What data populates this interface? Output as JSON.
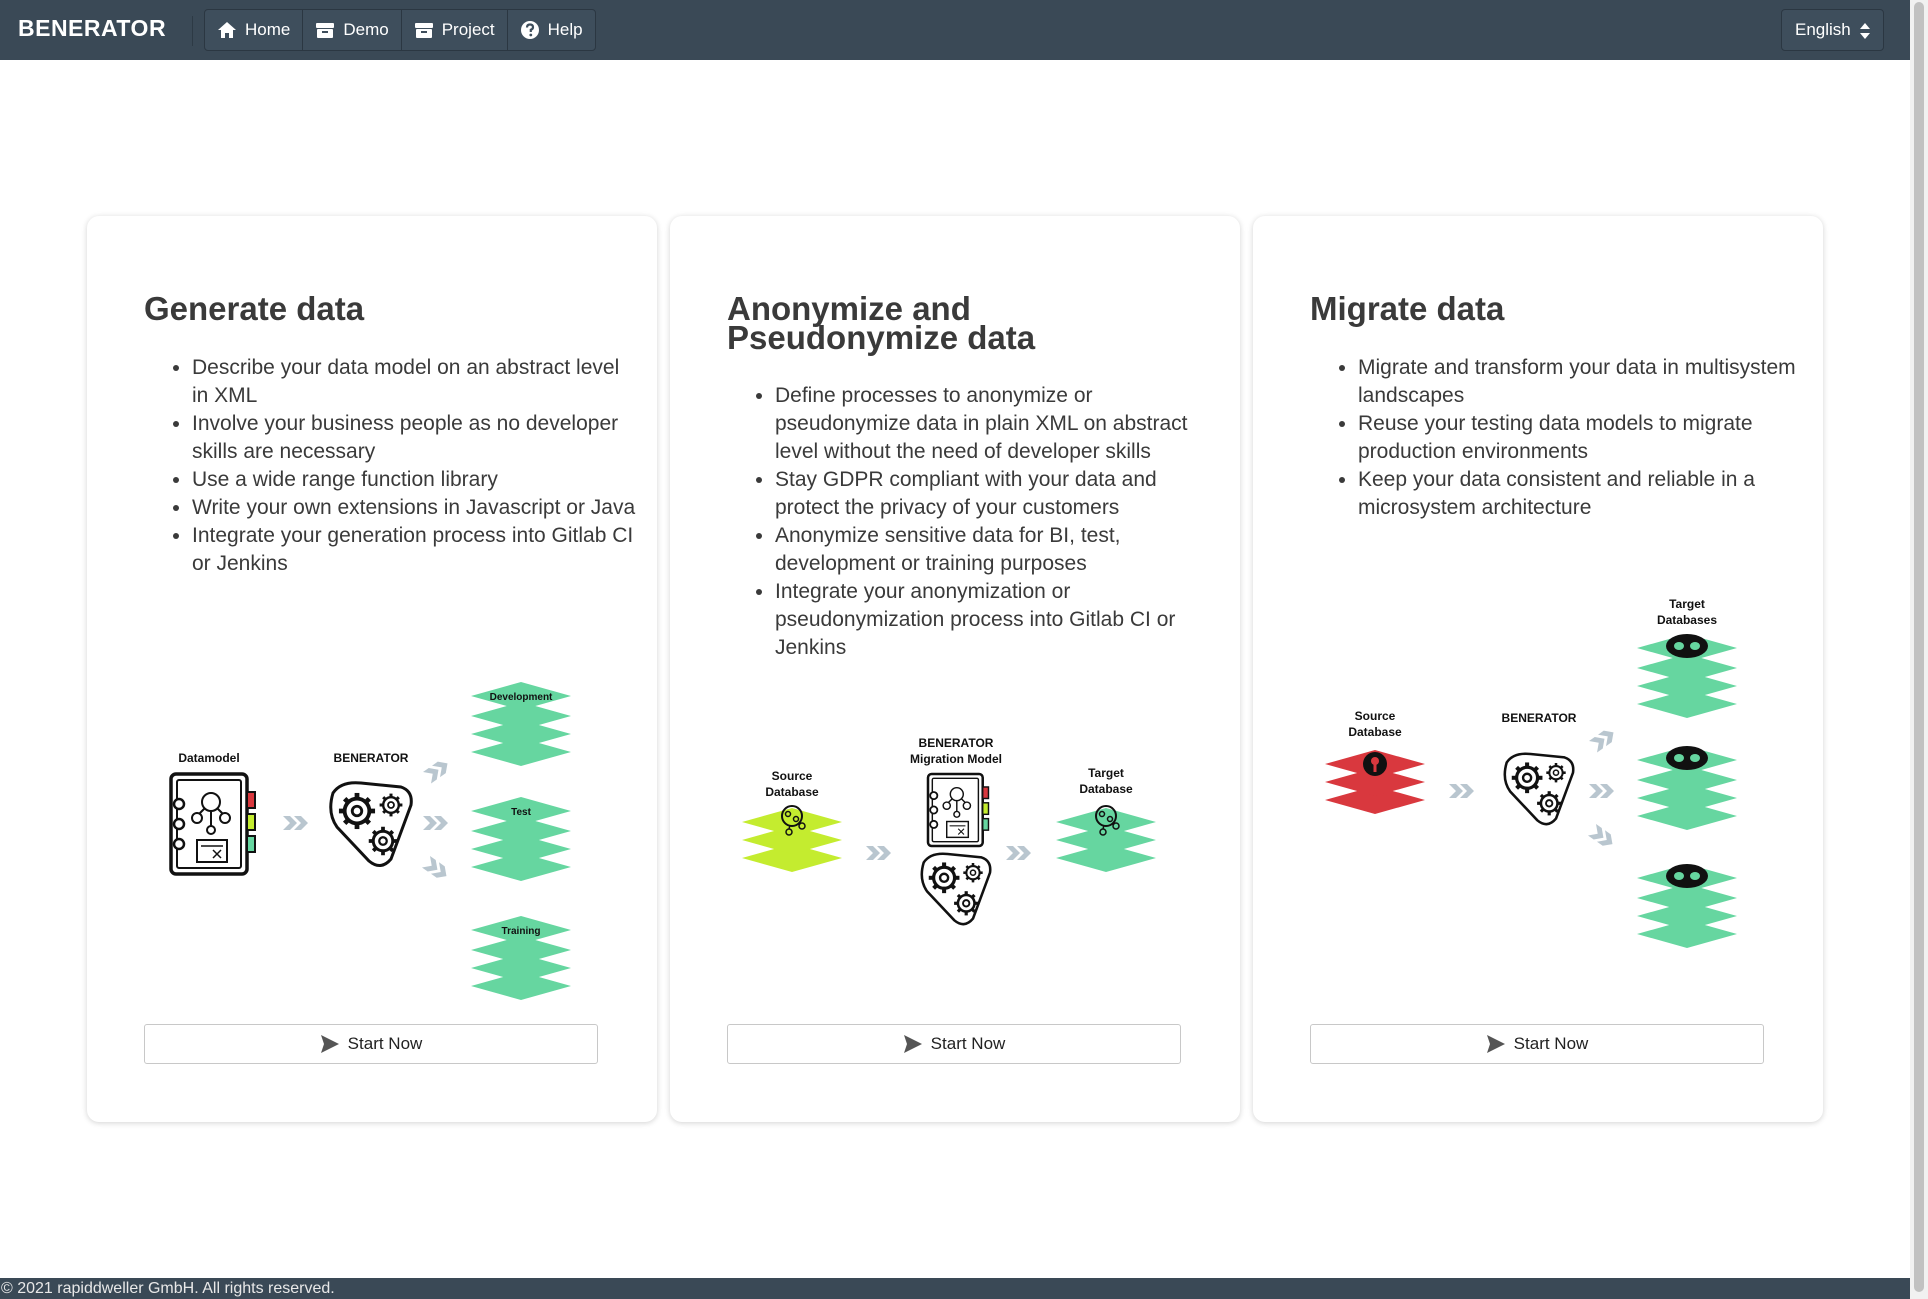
{
  "header": {
    "brand": "BENERATOR",
    "nav": [
      {
        "label": "Home",
        "icon": "home-icon"
      },
      {
        "label": "Demo",
        "icon": "box-icon"
      },
      {
        "label": "Project",
        "icon": "box-icon"
      },
      {
        "label": "Help",
        "icon": "help-circle-icon"
      }
    ],
    "language": "English"
  },
  "cards": [
    {
      "title": "Generate data",
      "bullets": [
        "Describe your data model on an abstract level in XML",
        "Involve your business people as no developer skills are necessary",
        "Use a wide range function library",
        "Write your own extensions in Javascript or Java",
        "Integrate your generation process into Gitlab CI or Jenkins"
      ],
      "diagram": {
        "labels": [
          "Datamodel",
          "BENERATOR",
          "Development",
          "Test",
          "Training"
        ]
      },
      "button": "Start Now"
    },
    {
      "title": "Anonymize and Pseudonymize data",
      "bullets": [
        "Define processes to anonymize or pseudonymize data in plain XML on abstract level without the need of developer skills",
        "Stay GDPR compliant with your data and protect the privacy of your customers",
        "Anonymize sensitive data for BI, test, development or training purposes",
        "Integrate your anonymization or pseudonymization process into Gitlab CI or Jenkins"
      ],
      "diagram": {
        "labels": [
          "Source",
          "Database",
          "BENERATOR",
          "Migration Model",
          "Target",
          "Database"
        ]
      },
      "button": "Start Now"
    },
    {
      "title": "Migrate data",
      "bullets": [
        "Migrate and transform your data in multisystem landscapes",
        "Reuse your testing data models to migrate production environments",
        "Keep your data consistent and reliable in a microsystem architecture"
      ],
      "diagram": {
        "labels": [
          "Source",
          "Database",
          "BENERATOR",
          "Target",
          "Databases"
        ]
      },
      "button": "Start Now"
    }
  ],
  "footer": {
    "copyright": "© 2021 rapiddweller GmbH. All rights reserved."
  },
  "colors": {
    "navbar": "#3a4956",
    "green_stack": "#66d6a0",
    "lime_stack": "#c4ec2f",
    "red_stack": "#d9383e",
    "arrow": "#b9c6cf"
  }
}
